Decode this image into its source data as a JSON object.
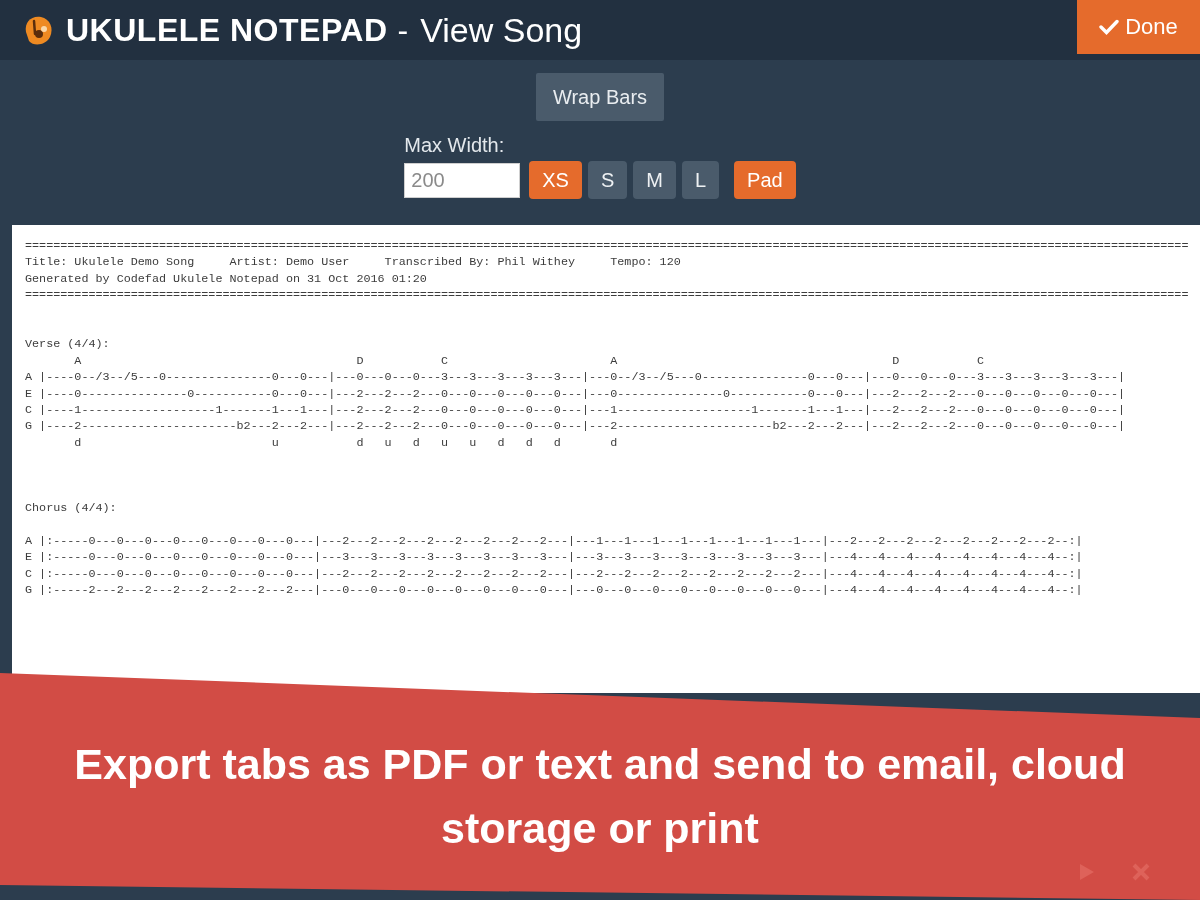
{
  "header": {
    "app_name": "UKULELE NOTEPAD",
    "separator": "-",
    "page_title": "View Song",
    "done_button": {
      "label": "Done"
    }
  },
  "controls": {
    "wrap_bars": {
      "label": "Wrap Bars",
      "on": false
    },
    "max_width": {
      "label": "Max Width:",
      "value": "200"
    },
    "sizes": [
      {
        "label": "XS",
        "selected": true
      },
      {
        "label": "S",
        "selected": false
      },
      {
        "label": "M",
        "selected": false
      },
      {
        "label": "L",
        "selected": false
      }
    ],
    "pad": {
      "label": "Pad",
      "on": true
    }
  },
  "tab_sheet": {
    "header_lines": [
      "=====================================================================================================================================================================",
      "Title: Ukulele Demo Song     Artist: Demo User     Transcribed By: Phil Withey     Tempo: 120",
      "Generated by Codefad Ukulele Notepad on 31 Oct 2016 01:20",
      "====================================================================================================================================================================="
    ],
    "sections": [
      {
        "heading": "Verse (4/4):",
        "chords": "       A                                       D           C                       A                                       D           C",
        "strings": [
          "A |----0--/3--/5---0---------------0---0---|---0---0---0---3---3---3---3---3---|---0--/3--/5---0---------------0---0---|---0---0---0---3---3---3---3---3---|",
          "E |----0---------------0-----------0---0---|---2---2---2---0---0---0---0---0---|---0---------------0-----------0---0---|---2---2---2---0---0---0---0---0---|",
          "C |----1-------------------1-------1---1---|---2---2---2---0---0---0---0---0---|---1-------------------1-------1---1---|---2---2---2---0---0---0---0---0---|",
          "G |----2----------------------b2---2---2---|---2---2---2---0---0---0---0---0---|---2----------------------b2---2---2---|---2---2---2---0---0---0---0---0---|"
        ],
        "strums": "       d                           u           d   u   d   u   u   d   d   d       d"
      },
      {
        "heading": "Chorus (4/4):",
        "strings": [
          "A |:-----0---0---0---0---0---0---0---0---|---2---2---2---2---2---2---2---2---|---1---1---1---1---1---1---1---1---|---2---2---2---2---2---2---2---2--:|",
          "E |:-----0---0---0---0---0---0---0---0---|---3---3---3---3---3---3---3---3---|---3---3---3---3---3---3---3---3---|---4---4---4---4---4---4---4---4--:|",
          "C |:-----0---0---0---0---0---0---0---0---|---2---2---2---2---2---2---2---2---|---2---2---2---2---2---2---2---2---|---4---4---4---4---4---4---4---4--:|",
          "G |:-----2---2---2---2---2---2---2---2---|---0---0---0---0---0---0---0---0---|---0---0---0---0---0---0---0---0---|---4---4---4---4---4---4---4---4--:|"
        ]
      }
    ]
  },
  "banner": {
    "caption": "Export tabs as PDF or text and send to email, cloud storage or print"
  }
}
